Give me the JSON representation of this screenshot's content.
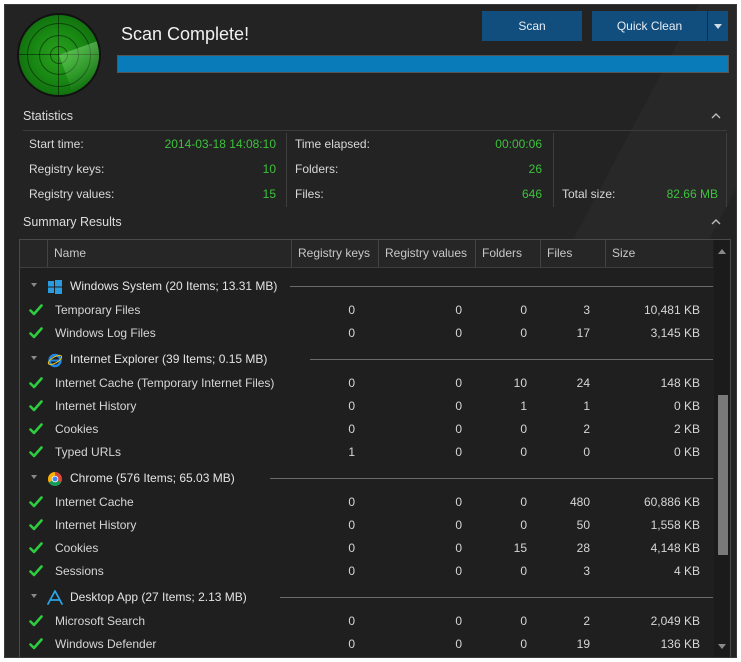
{
  "header": {
    "title": "Scan Complete!",
    "progress_fraction": 1.0,
    "scan_label": "Scan",
    "quick_clean_label": "Quick Clean"
  },
  "statistics": {
    "title": "Statistics",
    "start_time_label": "Start time:",
    "start_time": "2014-03-18 14:08:10",
    "registry_keys_label": "Registry keys:",
    "registry_keys": "10",
    "registry_values_label": "Registry values:",
    "registry_values": "15",
    "time_elapsed_label": "Time elapsed:",
    "time_elapsed": "00:00:06",
    "folders_label": "Folders:",
    "folders": "26",
    "files_label": "Files:",
    "files": "646",
    "total_size_label": "Total size:",
    "total_size": "82.66 MB"
  },
  "summary": {
    "title": "Summary Results",
    "columns": [
      "Name",
      "Registry keys",
      "Registry values",
      "Folders",
      "Files",
      "Size"
    ],
    "groups": [
      {
        "label": "Windows System (20 Items; 13.31 MB)",
        "icon": "windows-icon",
        "rows": [
          {
            "name": "Temporary Files",
            "rk": "0",
            "rv": "0",
            "folders": "0",
            "files": "3",
            "size": "10,481 KB"
          },
          {
            "name": "Windows Log Files",
            "rk": "0",
            "rv": "0",
            "folders": "0",
            "files": "17",
            "size": "3,145 KB"
          }
        ]
      },
      {
        "label": "Internet Explorer (39 Items; 0.15 MB)",
        "icon": "internet-explorer-icon",
        "rows": [
          {
            "name": "Internet Cache (Temporary Internet Files)",
            "rk": "0",
            "rv": "0",
            "folders": "10",
            "files": "24",
            "size": "148 KB"
          },
          {
            "name": "Internet History",
            "rk": "0",
            "rv": "0",
            "folders": "1",
            "files": "1",
            "size": "0 KB"
          },
          {
            "name": "Cookies",
            "rk": "0",
            "rv": "0",
            "folders": "0",
            "files": "2",
            "size": "2 KB"
          },
          {
            "name": "Typed URLs",
            "rk": "1",
            "rv": "0",
            "folders": "0",
            "files": "0",
            "size": "0 KB"
          }
        ]
      },
      {
        "label": "Chrome (576 Items; 65.03 MB)",
        "icon": "chrome-icon",
        "rows": [
          {
            "name": "Internet Cache",
            "rk": "0",
            "rv": "0",
            "folders": "0",
            "files": "480",
            "size": "60,886 KB"
          },
          {
            "name": "Internet History",
            "rk": "0",
            "rv": "0",
            "folders": "0",
            "files": "50",
            "size": "1,558 KB"
          },
          {
            "name": "Cookies",
            "rk": "0",
            "rv": "0",
            "folders": "15",
            "files": "28",
            "size": "4,148 KB"
          },
          {
            "name": "Sessions",
            "rk": "0",
            "rv": "0",
            "folders": "0",
            "files": "3",
            "size": "4 KB"
          }
        ]
      },
      {
        "label": "Desktop App (27 Items; 2.13 MB)",
        "icon": "desktop-app-icon",
        "rows": [
          {
            "name": "Microsoft Search",
            "rk": "0",
            "rv": "0",
            "folders": "0",
            "files": "2",
            "size": "2,049 KB"
          },
          {
            "name": "Windows Defender",
            "rk": "0",
            "rv": "0",
            "folders": "0",
            "files": "19",
            "size": "136 KB"
          }
        ]
      }
    ]
  },
  "colors": {
    "accent_blue": "#0a7bb9",
    "button_blue": "#114d7d",
    "value_green": "#3dc13d",
    "check_green": "#2ecc40",
    "background": "#232323"
  }
}
